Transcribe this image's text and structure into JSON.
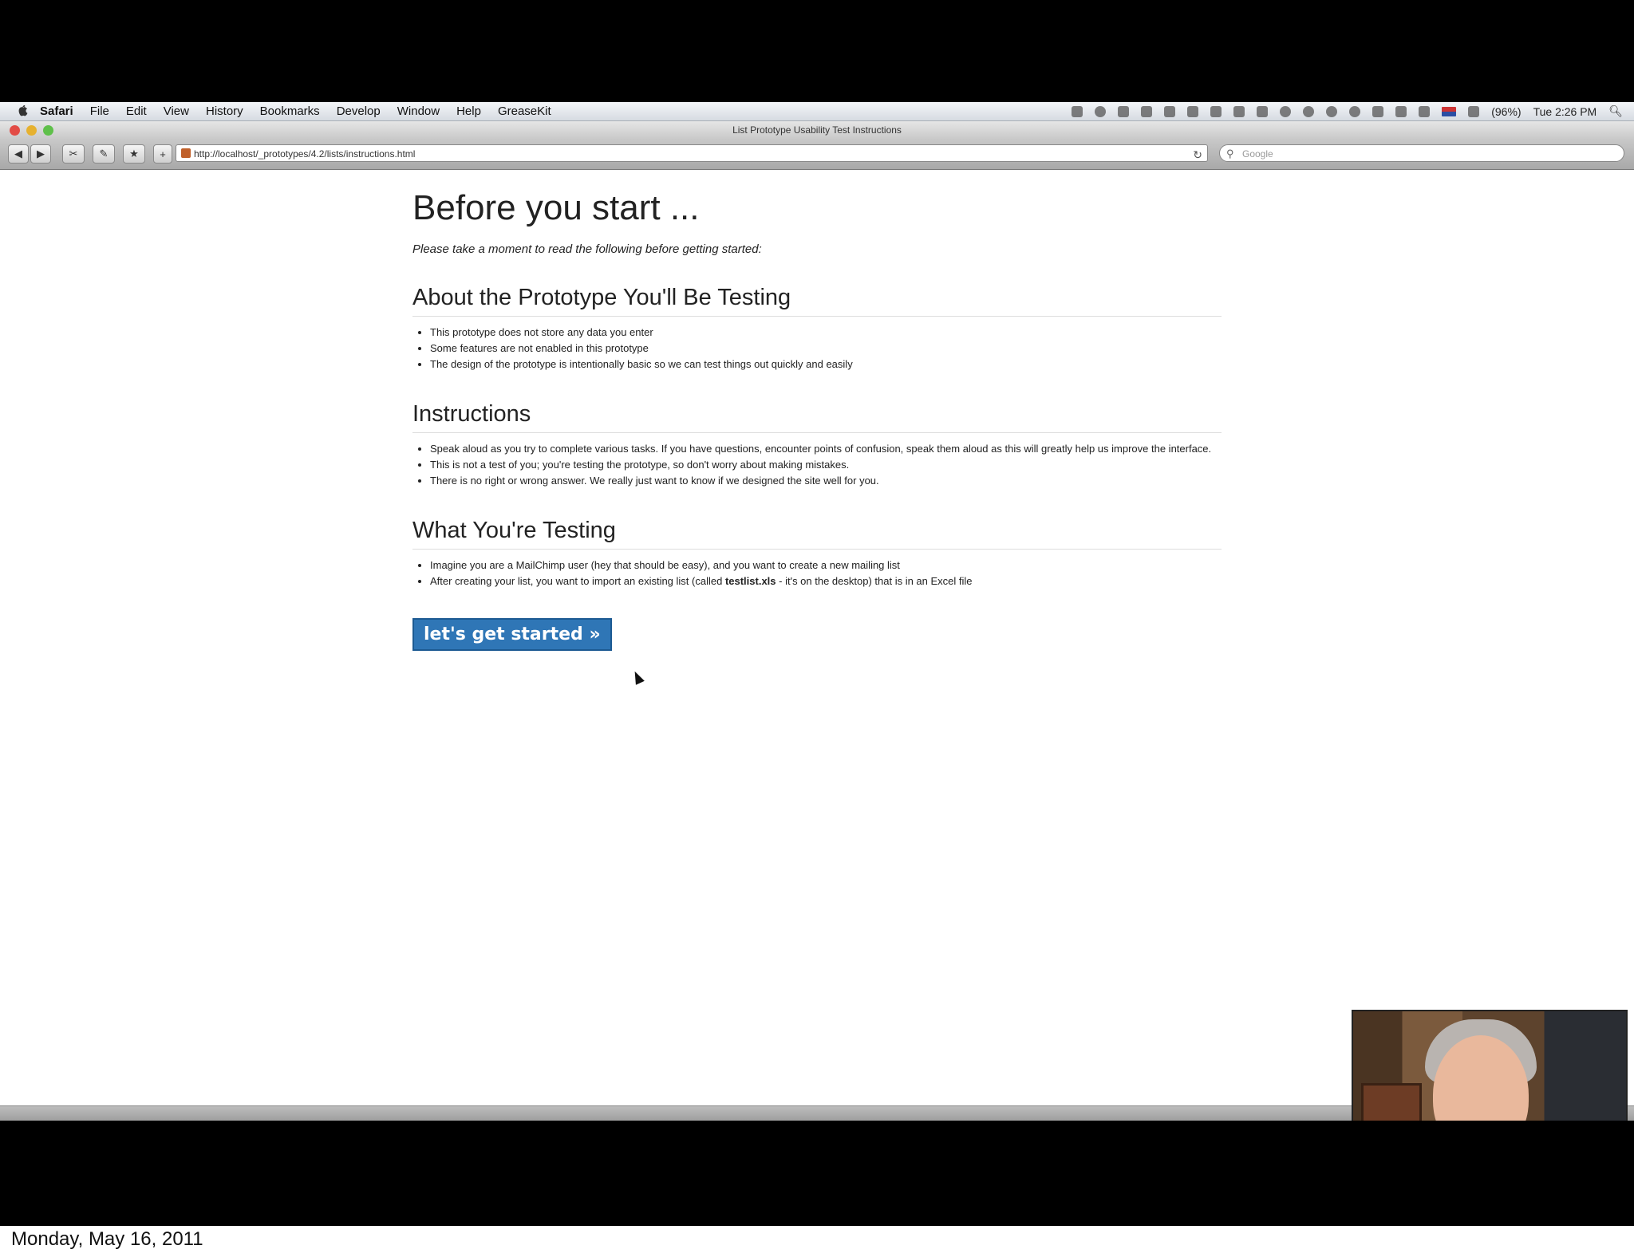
{
  "menubar": {
    "app": "Safari",
    "items": [
      "File",
      "Edit",
      "View",
      "History",
      "Bookmarks",
      "Develop",
      "Window",
      "Help",
      "GreaseKit"
    ],
    "battery": "(96%)",
    "clock": "Tue 2:26 PM"
  },
  "window": {
    "title": "List Prototype Usability Test Instructions"
  },
  "toolbar": {
    "url": "http://localhost/_prototypes/4.2/lists/instructions.html",
    "search_placeholder": "Google"
  },
  "page": {
    "title": "Before you start ...",
    "intro": "Please take a moment to read the following before getting started:",
    "sections": [
      {
        "title": "About the Prototype You'll Be Testing",
        "items": [
          "This prototype does not store any data you enter",
          "Some features are not enabled in this prototype",
          "The design of the prototype is intentionally basic so we can test things out quickly and easily"
        ]
      },
      {
        "title": "Instructions",
        "items": [
          "Speak aloud as you try to complete various tasks. If you have questions, encounter points of confusion, speak them aloud as this will greatly help us improve the interface.",
          "This is not a test of you; you're testing the prototype, so don't worry about making mistakes.",
          "There is no right or wrong answer. We really just want to know if we designed the site well for you."
        ]
      },
      {
        "title": "What You're Testing",
        "items": [
          "Imagine you are a MailChimp user (hey that should be easy), and you want to create a new mailing list",
          "After creating your list, you want to import an existing list (called ",
          "testlist.xls",
          " - it's on the desktop) that is in an Excel file"
        ]
      }
    ],
    "cta": "let's get started »"
  },
  "slide_footer": {
    "date": "Monday, May 16, 2011"
  }
}
